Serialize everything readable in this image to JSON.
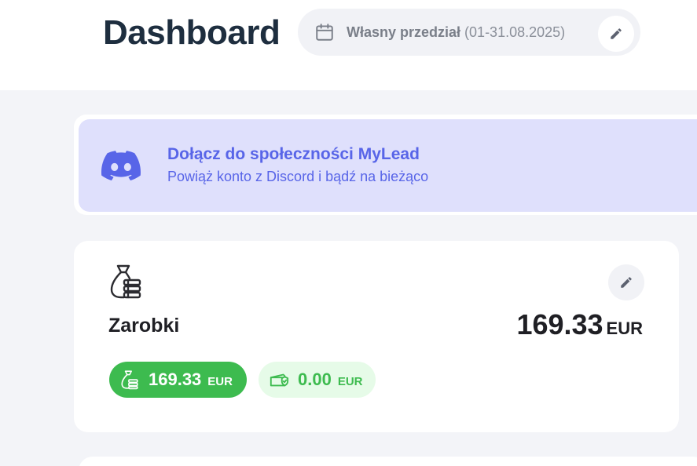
{
  "header": {
    "title": "Dashboard",
    "date_range": {
      "label_bold": "Własny przedział",
      "label_range": " (01-31.08.2025)",
      "calendar_icon": "calendar-icon",
      "edit_icon": "pencil-icon"
    }
  },
  "discord_banner": {
    "title": "Dołącz do społeczności MyLead",
    "subtitle": "Powiąż konto z Discord i bądź na bieżąco",
    "icon": "discord-icon",
    "color": "#5865e8"
  },
  "earnings": {
    "label": "Zarobki",
    "total_value": "169.33",
    "total_currency": "EUR",
    "icon": "money-bag-icon",
    "edit_icon": "pencil-icon",
    "chips": [
      {
        "value": "169.33",
        "currency": "EUR",
        "icon": "money-bag-icon",
        "color": "#3dbb4f"
      },
      {
        "value": "0.00",
        "currency": "EUR",
        "icon": "cash-shield-icon",
        "color": "#e6fbe8"
      }
    ]
  }
}
